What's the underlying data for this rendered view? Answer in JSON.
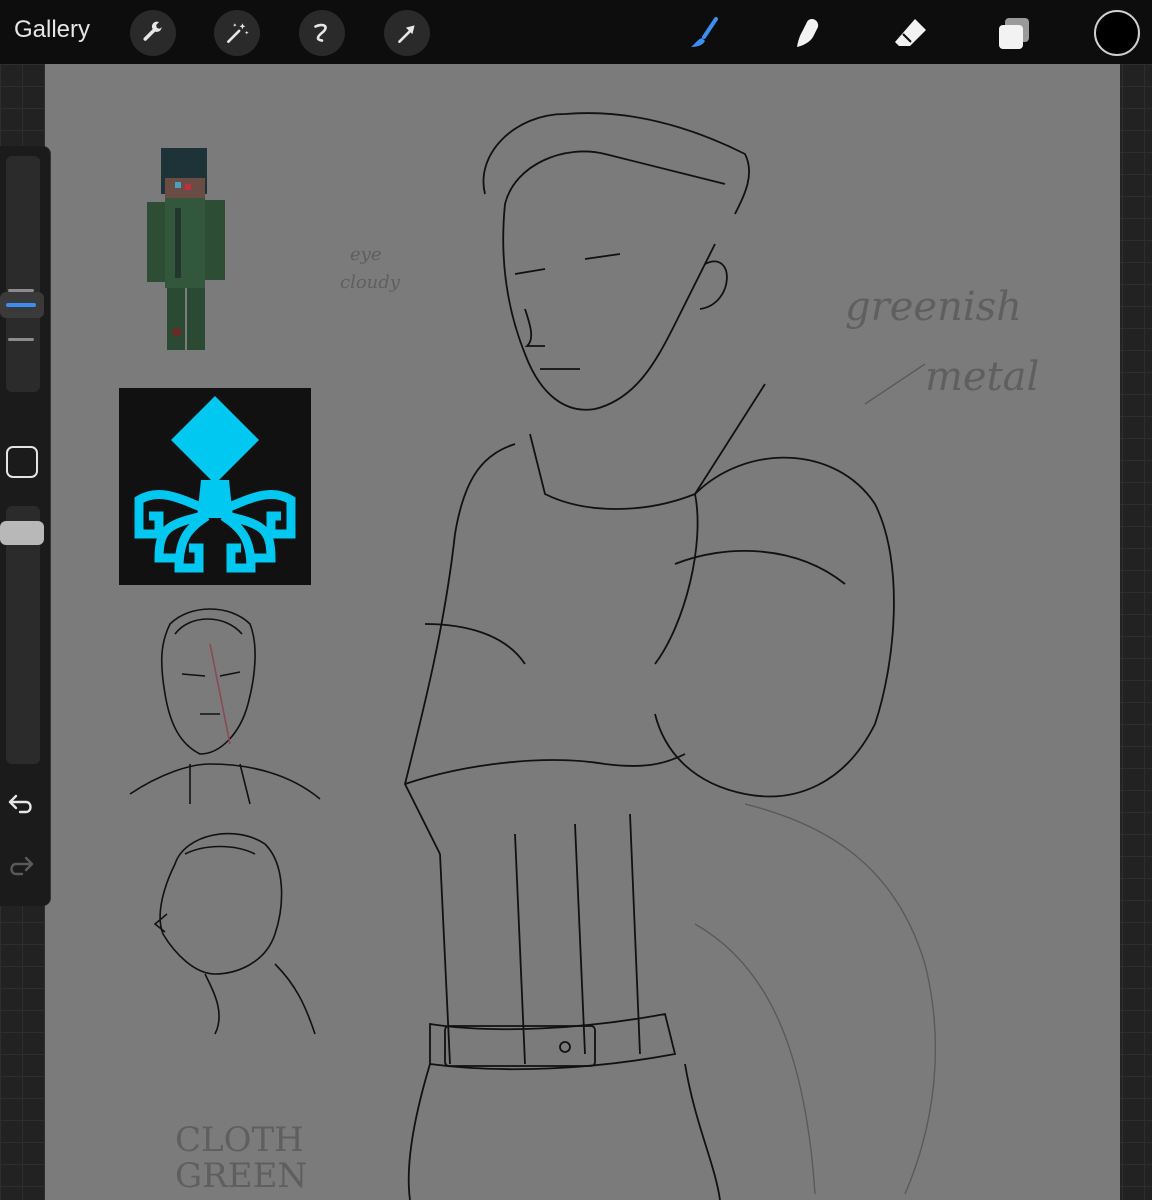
{
  "topbar": {
    "gallery_label": "Gallery",
    "left_tools": [
      "wrench-icon",
      "magic-wand-icon",
      "selection-icon",
      "transform-arrow-icon"
    ],
    "right_tools": [
      "brush-icon",
      "smudge-icon",
      "eraser-icon",
      "layers-icon"
    ],
    "active_tool": "brush-icon",
    "accent_color": "#3e8df0",
    "current_color": "#000000"
  },
  "canvas": {
    "background": "#7b7b7b",
    "notes": {
      "eye": "eye",
      "cloudy": "cloudy",
      "greenish": "greenish",
      "metal": "metal",
      "cloth": "CLOTH",
      "green": "GREEN"
    },
    "emblem_color": "#00c8f0"
  },
  "sidebar": {
    "undo_icon": "undo-icon",
    "redo_icon": "redo-icon"
  }
}
